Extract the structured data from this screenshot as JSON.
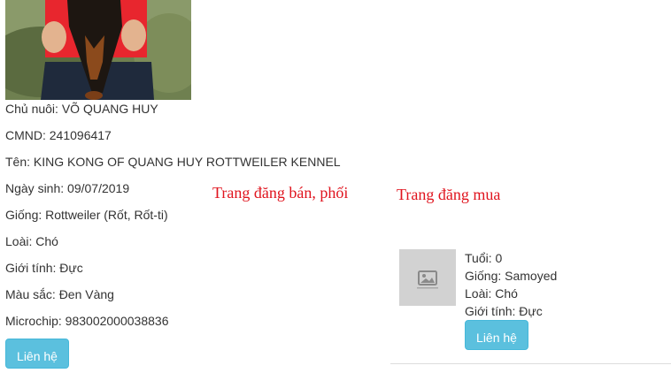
{
  "pet_listing": {
    "photo_icon": "dog-photo",
    "owner": "Chủ nuôi: VÕ QUANG HUY",
    "id_number": "CMND: 241096417",
    "name": "Tên: KING KONG OF QUANG HUY ROTTWEILER KENNEL",
    "birth_date": "Ngày sinh: 09/07/2019",
    "breed": "Giống: Rottweiler (Rốt, Rốt-ti)",
    "species": "Loài: Chó",
    "sex": "Giới tính: Đực",
    "color": "Màu sắc: Đen Vàng",
    "microchip": "Microchip: 983002000038836",
    "contact_label": "Liên hệ"
  },
  "notes": {
    "sell_page": "Trang đăng bán, phối",
    "buy_page": "Trang đăng mua"
  },
  "buy_listing": {
    "thumbnail_icon": "image-placeholder",
    "age": "Tuổi: 0",
    "breed": "Giống: Samoyed",
    "species": "Loài: Chó",
    "sex": "Giới tính: Đực",
    "contact_label": "Liên hệ"
  },
  "colors": {
    "button_bg": "#5bc0de",
    "note_text": "#e0141e",
    "text": "#333333"
  }
}
